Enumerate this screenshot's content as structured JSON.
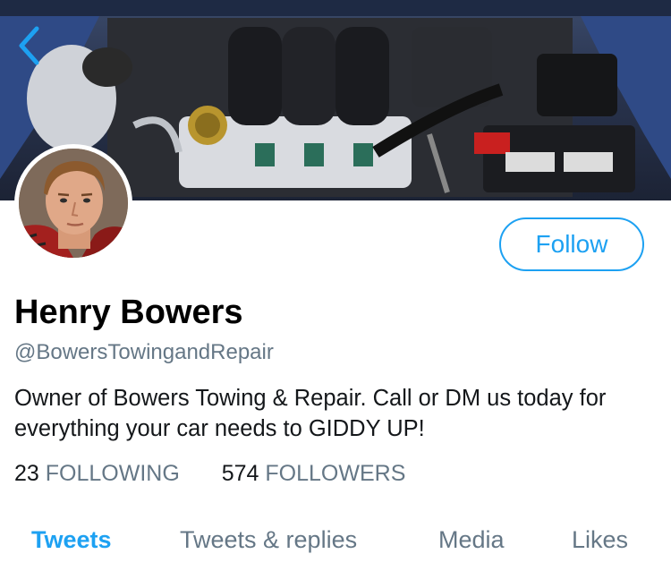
{
  "profile": {
    "name": "Henry Bowers",
    "handle": "@BowersTowingandRepair",
    "bio": "Owner of Bowers Towing & Repair. Call or DM us today for everything your car needs to GIDDY UP!",
    "follow_label": "Follow",
    "avatar_icon": "man-portrait",
    "header_image": "car-engine-bay"
  },
  "stats": {
    "following": {
      "count": "23",
      "label": "FOLLOWING"
    },
    "followers": {
      "count": "574",
      "label": "FOLLOWERS"
    }
  },
  "tabs": [
    {
      "label": "Tweets",
      "active": true
    },
    {
      "label": "Tweets & replies",
      "active": false
    },
    {
      "label": "Media",
      "active": false
    },
    {
      "label": "Likes",
      "active": false
    }
  ],
  "colors": {
    "accent": "#1da1f2",
    "secondary_text": "#657786",
    "primary_text": "#14171a"
  }
}
